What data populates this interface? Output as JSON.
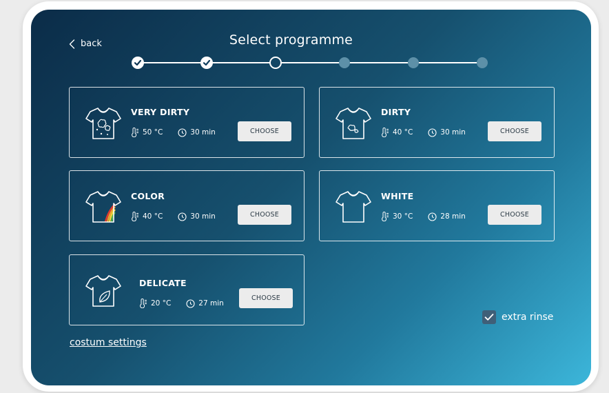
{
  "header": {
    "back_label": "back",
    "title": "Select programme"
  },
  "stepper": {
    "steps": [
      "done",
      "done",
      "current",
      "todo",
      "todo",
      "todo"
    ]
  },
  "programmes": [
    {
      "name": "VERY DIRTY",
      "temp": "50 °C",
      "time": "30 min",
      "action": "CHOOSE"
    },
    {
      "name": "DIRTY",
      "temp": "40 °C",
      "time": "30 min",
      "action": "CHOOSE"
    },
    {
      "name": "COLOR",
      "temp": "40 °C",
      "time": "30 min",
      "action": "CHOOSE"
    },
    {
      "name": "WHITE",
      "temp": "30 °C",
      "time": "28 min",
      "action": "CHOOSE"
    },
    {
      "name": "DELICATE",
      "temp": "20 °C",
      "time": "27 min",
      "action": "CHOOSE"
    }
  ],
  "options": {
    "extra_rinse_label": "extra rinse",
    "extra_rinse_checked": true
  },
  "footer": {
    "custom_settings_label": "costum settings"
  },
  "colors": {
    "gradient_start": "#0b2c48",
    "gradient_end": "#3cb6da",
    "button_bg": "#ececec",
    "step_todo": "#5d90a8",
    "checkbox_bg": "#3f5f78"
  },
  "icons": {
    "back": "chevron-left-icon",
    "step_done": "check-icon",
    "temperature": "thermometer-icon",
    "time": "clock-icon",
    "shirt_dirty": "stained-shirt-icon",
    "shirt_color": "rainbow-shirt-icon",
    "shirt_white": "shirt-icon",
    "shirt_delicate": "leaf-shirt-icon",
    "checkbox": "check-icon"
  }
}
